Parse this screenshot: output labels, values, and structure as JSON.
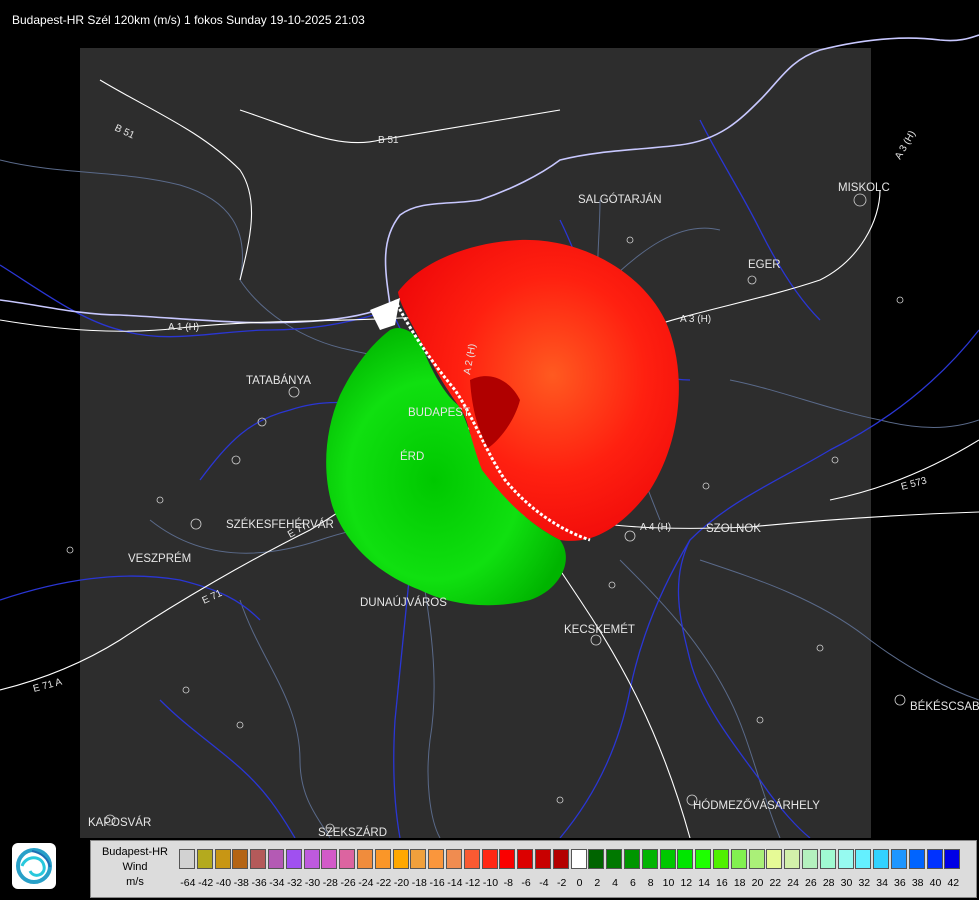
{
  "title": "Budapest-HR Szél 120km (m/s) 1 fokos Sunday 19-10-2025 21:03",
  "cities": [
    {
      "id": "salgotarjan",
      "name": "SALGÓTARJÁN"
    },
    {
      "id": "miskolc",
      "name": "MISKOLC"
    },
    {
      "id": "eger",
      "name": "EGER"
    },
    {
      "id": "tatabanya",
      "name": "TATABÁNYA"
    },
    {
      "id": "budapest",
      "name": "BUDAPEST"
    },
    {
      "id": "erd",
      "name": "ÉRD"
    },
    {
      "id": "szekesfehervar",
      "name": "SZÉKESFEHÉRVÁR"
    },
    {
      "id": "veszprem",
      "name": "VESZPRÉM"
    },
    {
      "id": "dunaujvaros",
      "name": "DUNAÚJVÁROS"
    },
    {
      "id": "kecskemet",
      "name": "KECSKEMÉT"
    },
    {
      "id": "szolnok",
      "name": "SZOLNOK"
    },
    {
      "id": "bekescsaba",
      "name": "BÉKÉSCSABA"
    },
    {
      "id": "hodmezovasarhely",
      "name": "HÓDMEZŐVÁSÁRHELY"
    },
    {
      "id": "kaposvar",
      "name": "KAPOSVÁR"
    },
    {
      "id": "szekszard",
      "name": "SZEKSZÁRD"
    }
  ],
  "roads": [
    {
      "id": "b51a",
      "name": "B 51"
    },
    {
      "id": "b51b",
      "name": "B 51"
    },
    {
      "id": "a3n",
      "name": "A 3 (H)"
    },
    {
      "id": "a3",
      "name": "A 3 (H)"
    },
    {
      "id": "a1",
      "name": "A 1 (H)"
    },
    {
      "id": "a2",
      "name": "A 2 (H)"
    },
    {
      "id": "e77",
      "name": "E 77"
    },
    {
      "id": "e71",
      "name": "E 71"
    },
    {
      "id": "e71b",
      "name": "E 71 A"
    },
    {
      "id": "a4",
      "name": "A 4 (H)"
    },
    {
      "id": "e573",
      "name": "E 573"
    }
  ],
  "legend": {
    "label_line1": "Budapest-HR",
    "label_line2": "Wind",
    "label_line3": "m/s",
    "ticks": [
      "-64",
      "-42",
      "-40",
      "-38",
      "-36",
      "-34",
      "-32",
      "-30",
      "-28",
      "-26",
      "-24",
      "-22",
      "-20",
      "-18",
      "-16",
      "-14",
      "-12",
      "-10",
      "-8",
      "-6",
      "-4",
      "-2",
      "0",
      "2",
      "4",
      "6",
      "8",
      "10",
      "12",
      "14",
      "16",
      "18",
      "20",
      "22",
      "24",
      "26",
      "28",
      "30",
      "32",
      "34",
      "36",
      "38",
      "40",
      "42"
    ],
    "colors": [
      "#d2d2d2",
      "#b4aa1e",
      "#c89614",
      "#b46414",
      "#b45a5a",
      "#b45ab4",
      "#a050f0",
      "#be5ade",
      "#d25ac8",
      "#dc64a0",
      "#f08c3c",
      "#fa9628",
      "#ffa800",
      "#f0a03c",
      "#fa963c",
      "#f08c50",
      "#fa5a32",
      "#ff2814",
      "#fa0000",
      "#dc0000",
      "#c80000",
      "#b40000",
      "#ffffff",
      "#006400",
      "#007800",
      "#009600",
      "#00b400",
      "#00c800",
      "#00e600",
      "#1eff00",
      "#50f000",
      "#82f050",
      "#aaf078",
      "#e6fa96",
      "#d2f0aa",
      "#b4f0be",
      "#a0fad2",
      "#96faf0",
      "#64f0ff",
      "#32d2ff",
      "#1e96ff",
      "#0064ff",
      "#0032ff",
      "#0000e6"
    ]
  },
  "colors": {
    "background": "#000000",
    "radar_area": "#2d2d2d",
    "rivers": "#2a36d4",
    "border": "#b4b4ff",
    "roads": "#ffffff",
    "approaching": "#00e000",
    "receding": "#ff2a10"
  }
}
